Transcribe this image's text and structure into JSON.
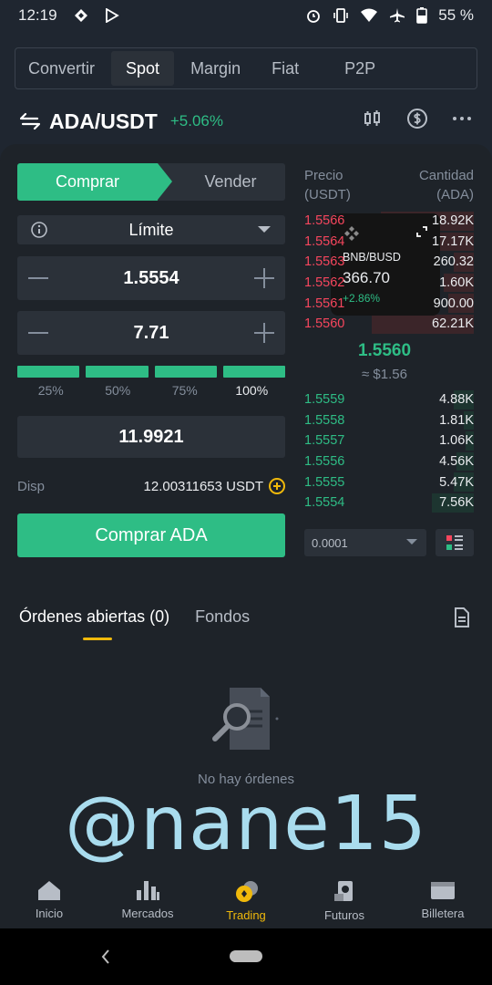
{
  "status_bar": {
    "time": "12:19",
    "battery": "55 %"
  },
  "top_tabs": [
    {
      "label": "Convertir",
      "active": false
    },
    {
      "label": "Spot",
      "active": true
    },
    {
      "label": "Margin",
      "active": false
    },
    {
      "label": "Fiat",
      "active": false
    },
    {
      "label": "P2P",
      "active": false
    }
  ],
  "pair": {
    "symbol": "ADA/USDT",
    "change": "+5.06%"
  },
  "trade_form": {
    "buy_tab": "Comprar",
    "sell_tab": "Vender",
    "order_type": "Límite",
    "price": "1.5554",
    "amount": "7.71",
    "percentages": [
      "25%",
      "50%",
      "75%",
      "100%"
    ],
    "total": "11.9921",
    "available_label": "Disp",
    "available_value": "12.00311653 USDT",
    "submit": "Comprar ADA"
  },
  "order_book": {
    "price_header_1": "Precio",
    "price_header_2": "(USDT)",
    "qty_header_1": "Cantidad",
    "qty_header_2": "(ADA)",
    "asks": [
      {
        "price": "1.5566",
        "qty": "18.92K",
        "depth": 0.55
      },
      {
        "price": "1.5564",
        "qty": "17.17K",
        "depth": 0.4
      },
      {
        "price": "1.5563",
        "qty": "260.32",
        "depth": 0.12
      },
      {
        "price": "1.5562",
        "qty": "1.60K",
        "depth": 0.18
      },
      {
        "price": "1.5561",
        "qty": "900.00",
        "depth": 0.15
      },
      {
        "price": "1.5560",
        "qty": "62.21K",
        "depth": 0.6
      }
    ],
    "mid_price": "1.5560",
    "mid_fiat": "≈ $1.56",
    "bids": [
      {
        "price": "1.5559",
        "qty": "4.88K",
        "depth": 0.12
      },
      {
        "price": "1.5558",
        "qty": "1.81K",
        "depth": 0.06
      },
      {
        "price": "1.5557",
        "qty": "1.06K",
        "depth": 0.05
      },
      {
        "price": "1.5556",
        "qty": "4.56K",
        "depth": 0.1
      },
      {
        "price": "1.5555",
        "qty": "5.47K",
        "depth": 0.12
      },
      {
        "price": "1.5554",
        "qty": "7.56K",
        "depth": 0.25
      }
    ],
    "tick_size": "0.0001"
  },
  "mini_ticker": {
    "pair": "BNB/BUSD",
    "price": "366.70",
    "change": "+2.86%"
  },
  "orders": {
    "tab_open": "Órdenes abiertas (0)",
    "tab_funds": "Fondos",
    "empty": "No hay órdenes"
  },
  "watermark": "@nane15",
  "bottom_nav": [
    {
      "label": "Inicio",
      "active": false
    },
    {
      "label": "Mercados",
      "active": false
    },
    {
      "label": "Trading",
      "active": true
    },
    {
      "label": "Futuros",
      "active": false
    },
    {
      "label": "Billetera",
      "active": false
    }
  ],
  "colors": {
    "buy": "#2ebd85",
    "sell": "#f6465d",
    "accent": "#f0b90b",
    "bg": "#1e2329"
  }
}
